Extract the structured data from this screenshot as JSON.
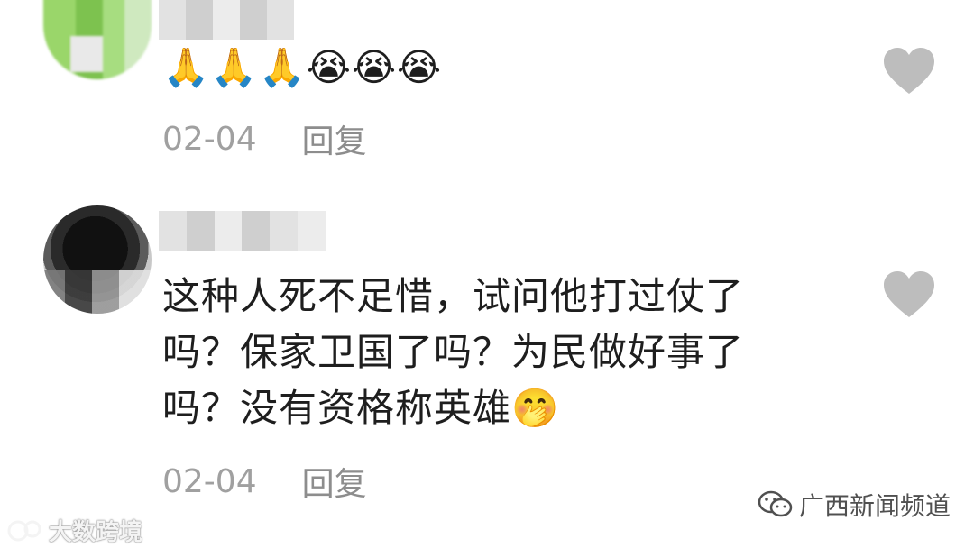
{
  "comments": [
    {
      "body": "🙏🙏🙏😭😭😭",
      "date": "02-04",
      "reply_label": "回复"
    },
    {
      "body_lines": [
        "这种人死不足惜，试问他打过仗了",
        "吗？保家卫国了吗？为民做好事了",
        "吗？没有资格称英雄"
      ],
      "trailing_emoji": "🤭",
      "date": "02-04",
      "reply_label": "回复"
    }
  ],
  "watermarks": {
    "left": "大数跨境",
    "right": "广西新闻频道"
  },
  "icons": {
    "like": "heart-icon",
    "wechat": "wechat-icon",
    "left_logo": "bubble-logo-icon"
  },
  "colors": {
    "text": "#1e1e1e",
    "meta": "#a0a0a0",
    "heart": "#bdbdbd"
  }
}
